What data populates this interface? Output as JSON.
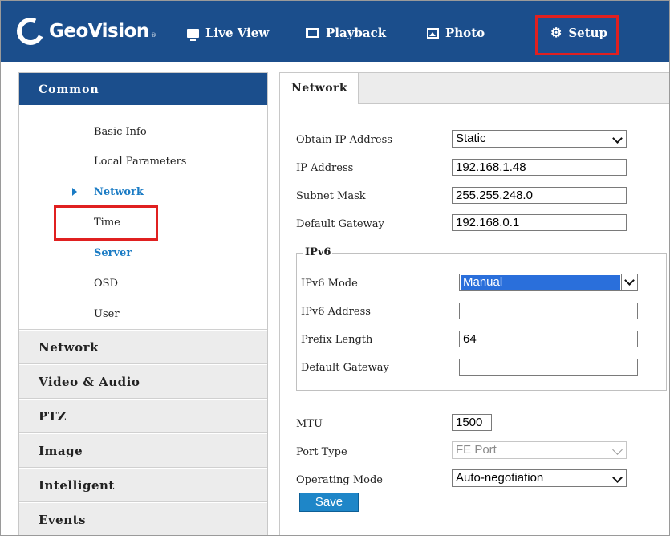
{
  "app": {
    "logo_text": "GeoVision",
    "logo_sup": "®"
  },
  "nav": {
    "items": [
      {
        "label": "Live View",
        "icon": "monitor-icon"
      },
      {
        "label": "Playback",
        "icon": "film-icon"
      },
      {
        "label": "Photo",
        "icon": "photo-icon"
      },
      {
        "label": "Setup",
        "icon": "gear-icon"
      }
    ],
    "active": "Setup"
  },
  "sidebar": {
    "header": "Common",
    "sub_items": [
      "Basic Info",
      "Local Parameters",
      "Network",
      "Time",
      "Server",
      "OSD",
      "User"
    ],
    "active_sub": "Network",
    "categories": [
      "Network",
      "Video & Audio",
      "PTZ",
      "Image",
      "Intelligent",
      "Events"
    ]
  },
  "content": {
    "tab": "Network",
    "obtain_ip": {
      "label": "Obtain IP Address",
      "value": "Static"
    },
    "ip_address": {
      "label": "IP Address",
      "value": "192.168.1.48"
    },
    "subnet_mask": {
      "label": "Subnet Mask",
      "value": "255.255.248.0"
    },
    "default_gateway": {
      "label": "Default Gateway",
      "value": "192.168.0.1"
    },
    "ipv6": {
      "legend": "IPv6",
      "mode": {
        "label": "IPv6 Mode",
        "value": "Manual"
      },
      "address": {
        "label": "IPv6 Address",
        "value": ""
      },
      "prefix_length": {
        "label": "Prefix Length",
        "value": "64"
      },
      "default_gateway": {
        "label": "Default Gateway",
        "value": ""
      }
    },
    "mtu": {
      "label": "MTU",
      "value": "1500"
    },
    "port_type": {
      "label": "Port Type",
      "value": "FE Port"
    },
    "operating_mode": {
      "label": "Operating Mode",
      "value": "Auto-negotiation"
    },
    "save_label": "Save"
  },
  "colors": {
    "nav_bg": "#1b4e8c",
    "accent": "#1a7bc4",
    "highlight": "#e02020",
    "save_button": "#1e86c8"
  }
}
